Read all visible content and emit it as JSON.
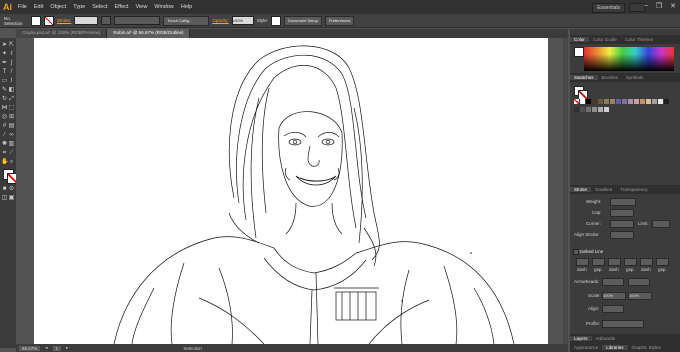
{
  "app": {
    "logo": "Ai"
  },
  "menu": [
    "File",
    "Edit",
    "Object",
    "Type",
    "Select",
    "Effect",
    "View",
    "Window",
    "Help"
  ],
  "workspace": "Essentials",
  "control_bar": {
    "selection": "No Selection",
    "stroke_label": "Stroke:",
    "brush_name": "Touch Callig...",
    "opacity_label": "Opacity:",
    "opacity_value": "100%",
    "style_label": "Style:",
    "doc_setup": "Document Setup",
    "preferences": "Preferences"
  },
  "tabs": [
    {
      "label": "Claylia.psd.ai* @ 100% (RGB/Preview)",
      "active": false
    },
    {
      "label": "Robin.ai* @ 66.67% (RGB/Outline)",
      "active": true
    }
  ],
  "status": {
    "zoom": "66.67%",
    "page": "1",
    "tool": "Selection"
  },
  "panels": {
    "color_tabs": [
      "Color",
      "Color Guide",
      "Color Themes"
    ],
    "swatch_tabs": [
      "Swatches",
      "Brushes",
      "Symbols"
    ],
    "stroke_tabs": [
      "Stroke",
      "Gradient",
      "Transparency"
    ],
    "stroke": {
      "weight": "Weight:",
      "cap": "Cap:",
      "corner": "Corner:",
      "limit": "Limit:",
      "align": "Align Stroke:",
      "dashed": "Dashed Line",
      "dash_labels": [
        "dash",
        "gap",
        "dash",
        "gap",
        "dash",
        "gap"
      ],
      "arrowheads": "Arrowheads:",
      "scale": "Scale:",
      "scale_values": [
        "100%",
        "100%"
      ],
      "align2": "Align:",
      "profile": "Profile:"
    },
    "bottom_tabs_1": [
      "Layers",
      "Artboards"
    ],
    "bottom_tabs_2": [
      "Appearance",
      "Libraries",
      "Graphic Styles"
    ]
  },
  "colors": {
    "accent": "#f79a1f",
    "menubar": "#323232",
    "panel": "#3c3c3c"
  }
}
